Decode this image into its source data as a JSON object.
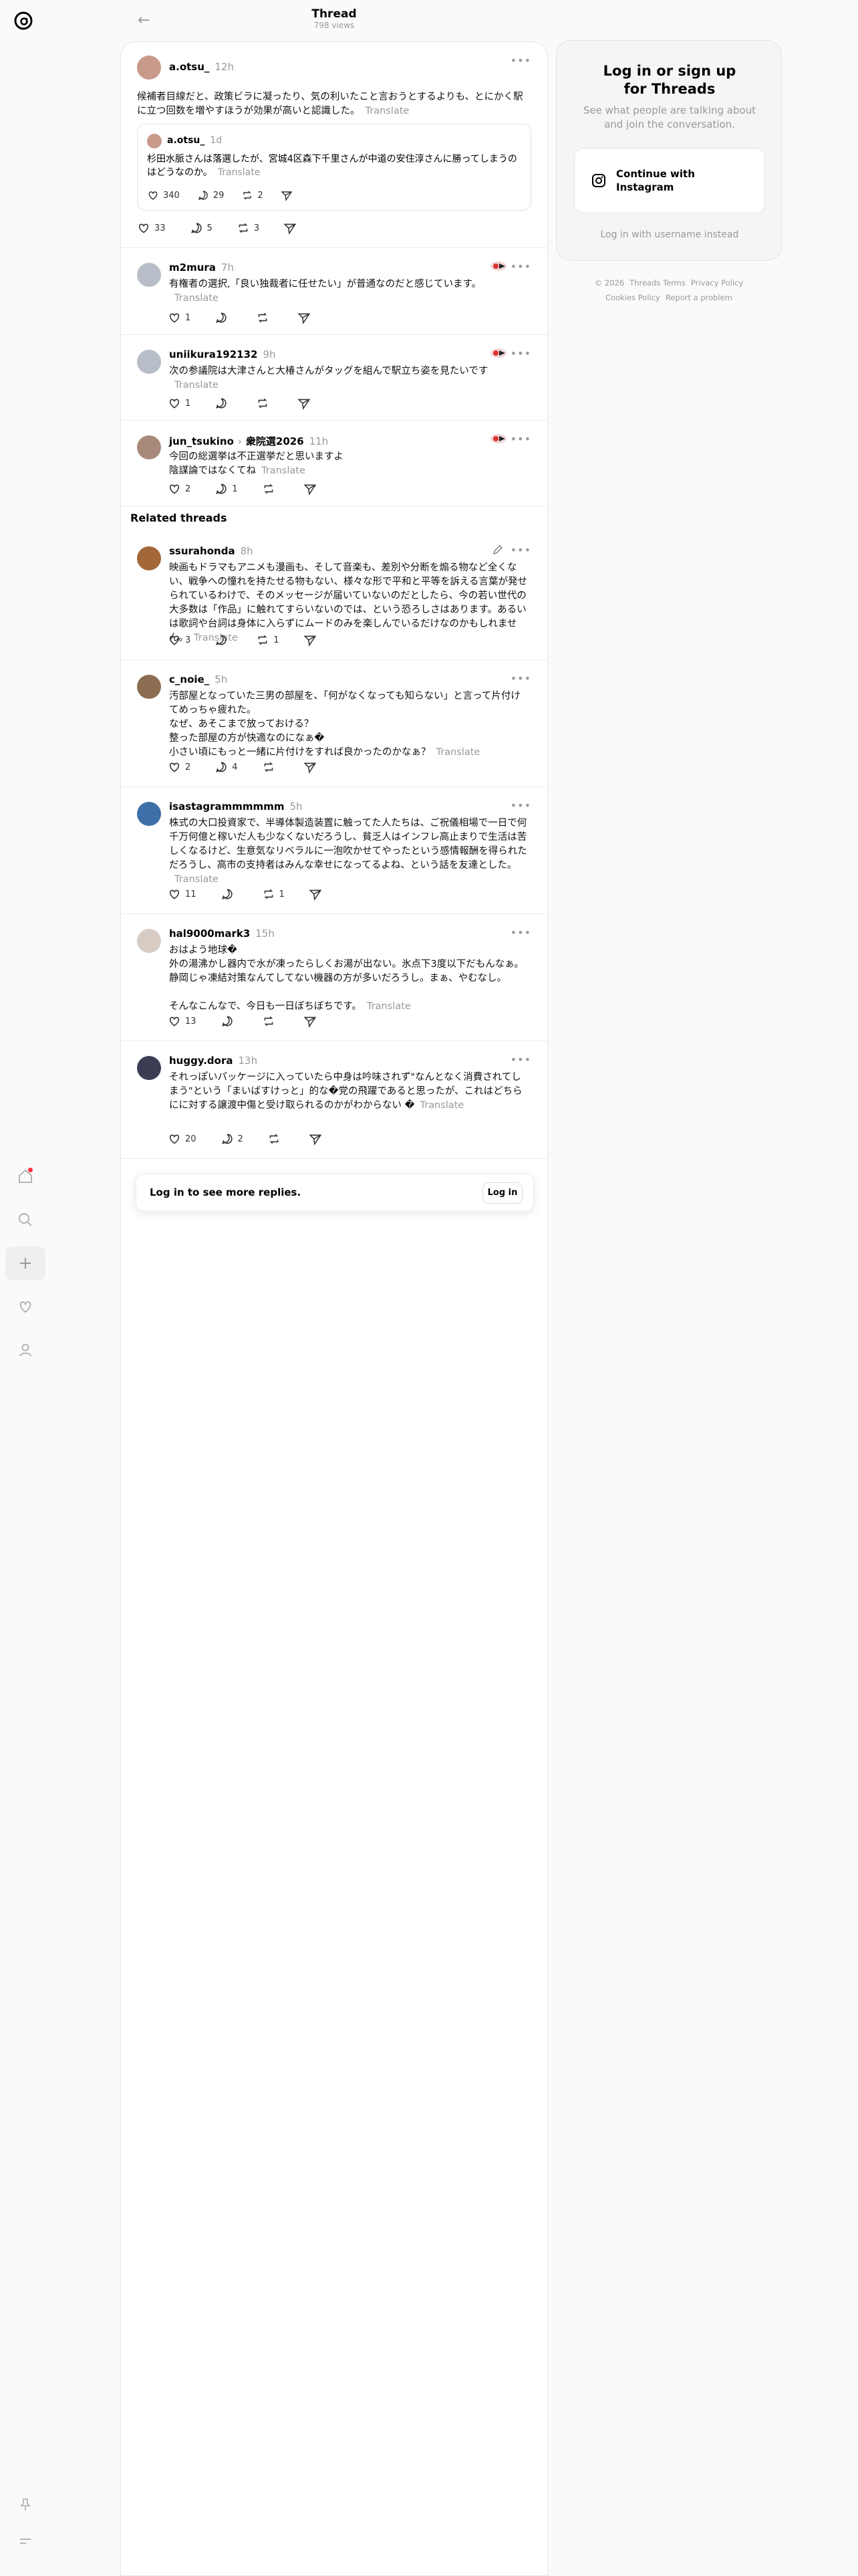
{
  "header": {
    "title": "Thread",
    "views": "798 views"
  },
  "root": {
    "username": "a.otsu_",
    "time": "12h",
    "text": "候補者目線だと、政策ビラに凝ったり、気の利いたこと言おうとするよりも、とにかく駅に立つ回数を増やすほうが効果が高いと認識した。",
    "translate": "Translate",
    "quote": {
      "username": "a.otsu_",
      "time": "1d",
      "text": "杉田水脈さんは落選したが、宮城4区森下千里さんが中道の安住淳さんに勝ってしまうのはどうなのか。",
      "translate": "Translate",
      "likes": "340",
      "replies": "29",
      "reposts": "2"
    },
    "likes": "33",
    "replies": "5",
    "reposts": "3"
  },
  "replies": [
    {
      "username": "m2mura",
      "time": "7h",
      "text": "有権者の選択,「良い独裁者に任せたい」が普通なのだと感じています。",
      "translate": "Translate",
      "likes": "1",
      "replies": "",
      "reposts": ""
    },
    {
      "username": "uniikura192132",
      "time": "9h",
      "text": "次の参議院は大津さんと大椿さんがタッグを組んで駅立ち姿を見たいです",
      "translate": "Translate",
      "likes": "1",
      "replies": "",
      "reposts": ""
    },
    {
      "username": "jun_tsukino",
      "tag": "衆院選2026",
      "time": "11h",
      "text": "今回の総選挙は不正選挙だと思いますよ\n陰謀論ではなくてね",
      "translate": "Translate",
      "likes": "2",
      "replies": "1",
      "reposts": ""
    }
  ],
  "related_title": "Related threads",
  "related": [
    {
      "username": "ssurahonda",
      "time": "8h",
      "text": "映画もドラマもアニメも漫画も、そして音楽も、差別や分断を煽る物など全くない、戦争への憧れを持たせる物もない、様々な形で平和と平等を訴える言葉が発せられているわけで、そのメッセージが届いていないのだとしたら、今の若い世代の大多数は「作品」に触れてすらいないのでは、という恐ろしさはあります。あるいは歌詞や台詞は身体に入らずにムードのみを楽しんでいるだけなのかもしれません。",
      "translate": "Translate",
      "likes": "3",
      "replies": "",
      "reposts": "1"
    },
    {
      "username": "c_noie_",
      "time": "5h",
      "text": "汚部屋となっていた三男の部屋を、「何がなくなっても知らない」と言って片付けてめっちゃ疲れた。\nなぜ、あそこまで放っておける？\n整った部屋の方が快適なのになぁ�\n小さい頃にもっと一緒に片付けをすれば良かったのかなぁ？",
      "translate": "Translate",
      "likes": "2",
      "replies": "4",
      "reposts": ""
    },
    {
      "username": "isastagrammmmmm",
      "time": "5h",
      "text": "株式の大口投資家で、半導体製造装置に触ってた人たちは、ご祝儀相場で一日で何千万何億と稼いだ人も少なくないだろうし、貧乏人はインフレ高止まりで生活は苦しくなるけど、生意気なリベラルに一泡吹かせてやったという感情報酬を得られただろうし、高市の支持者はみんな幸せになってるよね、という話を友達とした。",
      "translate": "Translate",
      "likes": "11",
      "replies": "",
      "reposts": "1"
    },
    {
      "username": "hal9000mark3",
      "time": "15h",
      "text": "おはよう地球�\n外の湯沸かし器内で水が凍ったらしくお湯が出ない。氷点下3度以下だもんなぁ。静岡じゃ凍結対策なんてしてない機器の方が多いだろうし。まぁ、やむなし。\n\nそんなこんなで、今日も一日ぼちぼちです。",
      "translate": "Translate",
      "likes": "13",
      "replies": "",
      "reposts": ""
    },
    {
      "username": "huggy.dora",
      "time": "13h",
      "text": "それっぽいパッケージに入っていたら中身は吟味されず\"なんとなく消費されてしまう\"という「まいばすけっと」的な�党の飛躍であると思ったが、これはどちらにに対する譲渡中傷と受け取られるのかがわからない �",
      "translate": "Translate",
      "likes": "20",
      "replies": "2",
      "reposts": ""
    }
  ],
  "login_more": {
    "text": "Log in to see more replies.",
    "button": "Log in"
  },
  "sidebar": {
    "heading": "Log in or sign up for Threads",
    "sub": "See what people are talking about and join the conversation.",
    "instagram_button": "Continue with Instagram",
    "alt_login": "Log in with username instead"
  },
  "footer": {
    "copyright": "© 2026",
    "links": [
      "Threads Terms",
      "Privacy Policy",
      "Cookies Policy",
      "Report a problem"
    ]
  }
}
